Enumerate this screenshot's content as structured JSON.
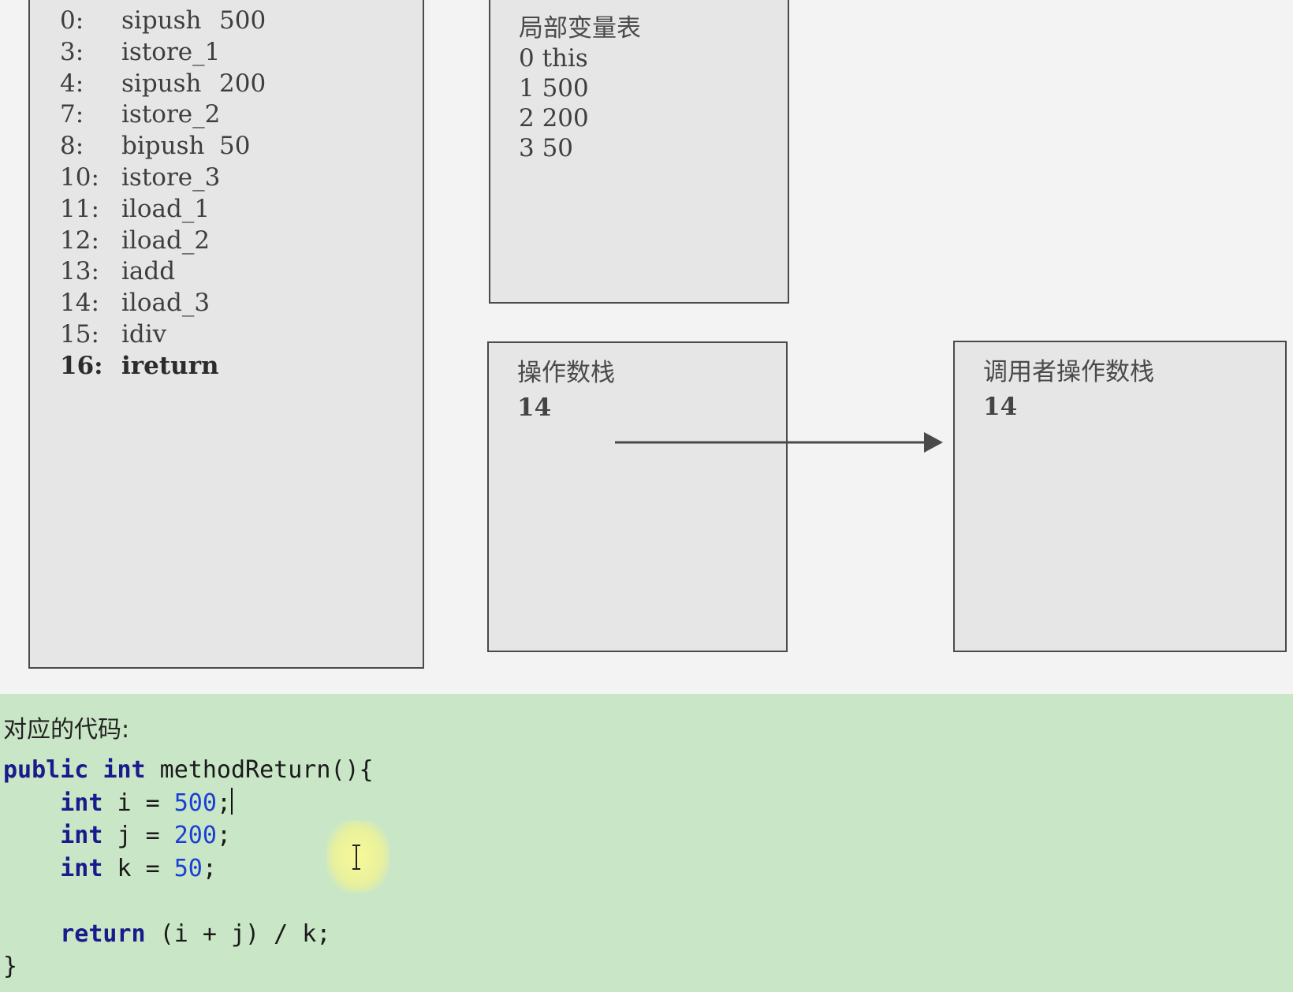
{
  "bytecode": [
    {
      "offset": "0:",
      "op": "sipush",
      "arg": "500"
    },
    {
      "offset": "3:",
      "op": "istore_1",
      "arg": ""
    },
    {
      "offset": "4:",
      "op": "sipush",
      "arg": "200"
    },
    {
      "offset": "7:",
      "op": "istore_2",
      "arg": ""
    },
    {
      "offset": "8:",
      "op": "bipush",
      "arg": "50"
    },
    {
      "offset": "10:",
      "op": "istore_3",
      "arg": ""
    },
    {
      "offset": "11:",
      "op": "iload_1",
      "arg": ""
    },
    {
      "offset": "12:",
      "op": "iload_2",
      "arg": ""
    },
    {
      "offset": "13:",
      "op": "iadd",
      "arg": ""
    },
    {
      "offset": "14:",
      "op": "iload_3",
      "arg": ""
    },
    {
      "offset": "15:",
      "op": "idiv",
      "arg": ""
    },
    {
      "offset": "16:",
      "op": "ireturn",
      "arg": ""
    }
  ],
  "local_vars": {
    "title": "局部变量表",
    "rows": [
      "0 this",
      "1 500",
      "2 200",
      "3 50"
    ]
  },
  "operand_stack": {
    "title": "操作数栈",
    "value": "14"
  },
  "caller_stack": {
    "title": "调用者操作数栈",
    "value": "14"
  },
  "code_section": {
    "caption": "对应的代码:",
    "lines": [
      "public int methodReturn(){",
      "    int i = 500;",
      "    int j = 200;",
      "    int k = 50;",
      "",
      "    return (i + j) / k;",
      "}"
    ]
  }
}
